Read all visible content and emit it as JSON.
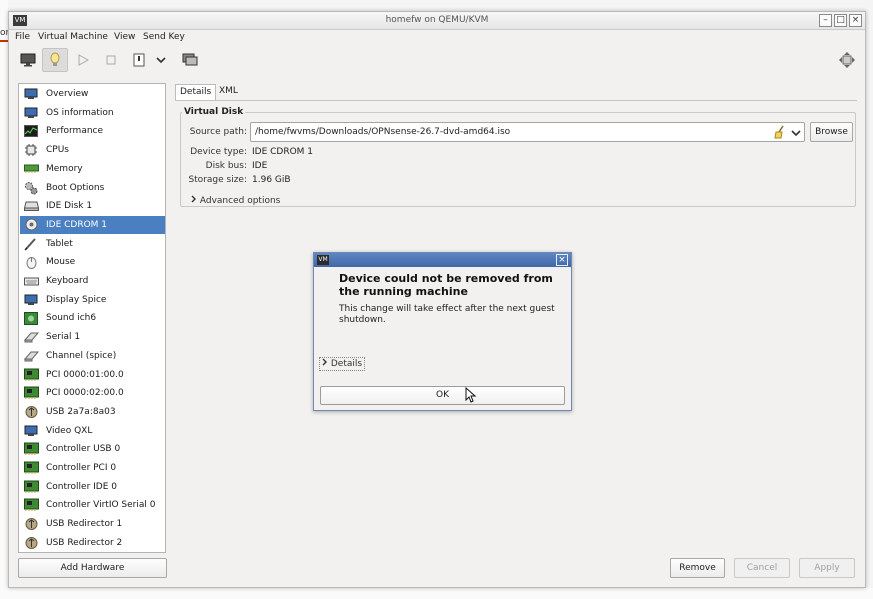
{
  "window": {
    "title": "homefw on QEMU/KVM",
    "app_icon": "VM"
  },
  "menubar": [
    "File",
    "Virtual Machine",
    "View",
    "Send Key"
  ],
  "toolbar": {
    "icons": [
      "monitor-icon",
      "lightbulb-icon",
      "play-icon",
      "pause-icon",
      "power-icon",
      "chevron-down-icon",
      "snapshots-icon",
      "fullscreen-icon"
    ]
  },
  "sidebar": {
    "selected": "IDE CDROM 1",
    "items": [
      {
        "label": "Overview",
        "icon": "monitor-icon"
      },
      {
        "label": "OS information",
        "icon": "monitor-icon"
      },
      {
        "label": "Performance",
        "icon": "performance-icon"
      },
      {
        "label": "CPUs",
        "icon": "cpu-icon"
      },
      {
        "label": "Memory",
        "icon": "memory-icon"
      },
      {
        "label": "Boot Options",
        "icon": "gears-icon"
      },
      {
        "label": "IDE Disk 1",
        "icon": "disk-icon"
      },
      {
        "label": "IDE CDROM 1",
        "icon": "cdrom-icon"
      },
      {
        "label": "Tablet",
        "icon": "tablet-icon"
      },
      {
        "label": "Mouse",
        "icon": "mouse-icon"
      },
      {
        "label": "Keyboard",
        "icon": "keyboard-icon"
      },
      {
        "label": "Display Spice",
        "icon": "monitor-icon"
      },
      {
        "label": "Sound ich6",
        "icon": "sound-icon"
      },
      {
        "label": "Serial 1",
        "icon": "serial-icon"
      },
      {
        "label": "Channel (spice)",
        "icon": "serial-icon"
      },
      {
        "label": "PCI 0000:01:00.0",
        "icon": "card-icon"
      },
      {
        "label": "PCI 0000:02:00.0",
        "icon": "card-icon"
      },
      {
        "label": "USB 2a7a:8a03",
        "icon": "usb-icon"
      },
      {
        "label": "Video QXL",
        "icon": "monitor-icon"
      },
      {
        "label": "Controller USB 0",
        "icon": "card-icon"
      },
      {
        "label": "Controller PCI 0",
        "icon": "card-icon"
      },
      {
        "label": "Controller IDE 0",
        "icon": "card-icon"
      },
      {
        "label": "Controller VirtIO Serial 0",
        "icon": "card-icon"
      },
      {
        "label": "USB Redirector 1",
        "icon": "usb-icon"
      },
      {
        "label": "USB Redirector 2",
        "icon": "usb-icon"
      }
    ]
  },
  "add_hardware_label": "Add Hardware",
  "tabs": [
    {
      "label": "Details",
      "active": true
    },
    {
      "label": "XML",
      "active": false
    }
  ],
  "details": {
    "section_title": "Virtual Disk",
    "source_path_label": "Source path:",
    "source_path_value": "/home/fwvms/Downloads/OPNsense-26.7-dvd-amd64.iso",
    "browse_label": "Browse",
    "device_type_label": "Device type:",
    "device_type_value": "IDE CDROM 1",
    "disk_bus_label": "Disk bus:",
    "disk_bus_value": "IDE",
    "storage_size_label": "Storage size:",
    "storage_size_value": "1.96 GiB",
    "advanced_label": "Advanced options"
  },
  "buttons": {
    "remove": "Remove",
    "cancel": "Cancel",
    "apply": "Apply"
  },
  "dialog": {
    "heading": "Device could not be removed from the running machine",
    "body": "This change will take effect after the next guest shutdown.",
    "details_label": "Details",
    "ok_label": "OK"
  },
  "colors": {
    "selection": "#4a7fc1",
    "dialog_title": "#4a73b4"
  }
}
